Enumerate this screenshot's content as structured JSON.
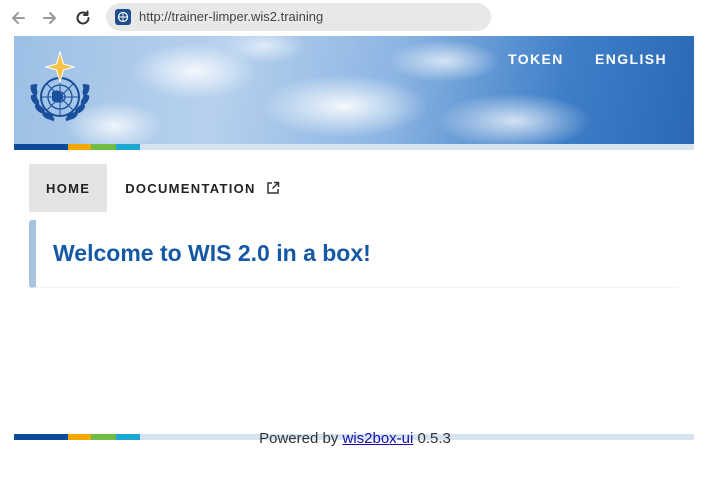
{
  "browser": {
    "url": "http://trainer-limper.wis2.training",
    "back_icon": "back-arrow-icon",
    "forward_icon": "forward-arrow-icon",
    "reload_icon": "reload-icon"
  },
  "header": {
    "nav": [
      {
        "label": "TOKEN"
      },
      {
        "label": "ENGLISH"
      }
    ],
    "logo_icon": "wmo-emblem-icon"
  },
  "tabs": [
    {
      "label": "HOME",
      "active": true
    },
    {
      "label": "DOCUMENTATION",
      "active": false,
      "icon": "external-link-icon"
    }
  ],
  "main": {
    "welcome_title": "Welcome to WIS 2.0 in a box!"
  },
  "footer": {
    "prefix": "Powered by ",
    "link_label": "wis2box-ui",
    "version": " 0.5.3"
  },
  "colors": {
    "stripe": [
      "#0b4b9a",
      "#f5a800",
      "#6fbd44",
      "#1aa7d1",
      "#d6e4f2"
    ],
    "title": "#1559a6",
    "accent_border": "#a9c2e0"
  }
}
